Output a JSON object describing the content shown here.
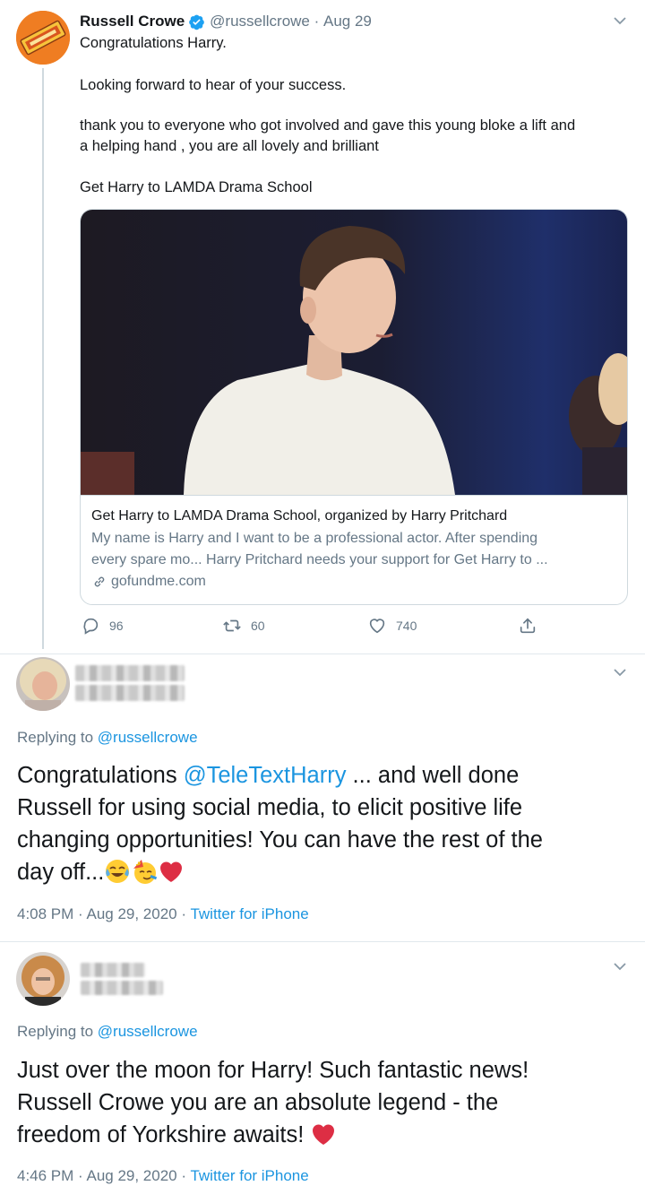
{
  "tweet": {
    "author_name": "Russell Crowe",
    "handle": "@russellcrowe",
    "date": "Aug 29",
    "line1": "Congratulations Harry.",
    "line2": "Looking forward to hear of your success.",
    "line3a": "thank you to everyone who got involved and gave this young bloke a lift and",
    "line3b": "a helping hand , you are all lovely and brilliant",
    "line4": "Get Harry to LAMDA Drama School",
    "card": {
      "title": "Get Harry to LAMDA Drama School, organized by Harry Pritchard",
      "desc1": "My name is Harry and I want to be a professional actor. After spending",
      "desc2": "every spare mo... Harry Pritchard needs your support for Get Harry to ...",
      "domain": "gofundme.com"
    },
    "actions": {
      "replies": "96",
      "retweets": "60",
      "likes": "740"
    }
  },
  "replies": [
    {
      "replying_label": "Replying to",
      "replying_handle": "@russellcrowe",
      "text_a": "Congratulations ",
      "mention": "@TeleTextHarry",
      "text_b": " ... and well done",
      "line2": "Russell for using social media, to elicit  positive life",
      "line3": "changing opportunities! You can have the rest of the",
      "line4": "day off...",
      "time": "4:08 PM · Aug 29, 2020 · ",
      "source": "Twitter for iPhone",
      "emojis": [
        "face-with-tears-of-joy",
        "partying-face",
        "red-heart"
      ]
    },
    {
      "replying_label": "Replying to",
      "replying_handle": "@russellcrowe",
      "line1": "Just over the moon for Harry! Such fantastic news!",
      "line2": "Russell Crowe you are an absolute legend - the",
      "line3": "freedom of Yorkshire awaits! ",
      "time": "4:46 PM · Aug 29, 2020 · ",
      "source": "Twitter for iPhone",
      "emojis": [
        "red-heart"
      ]
    }
  ],
  "colors": {
    "link_blue": "#1b95e0",
    "secondary_grey": "#657786",
    "verified_blue": "#1da1f2",
    "heart_red": "#e0245e"
  }
}
